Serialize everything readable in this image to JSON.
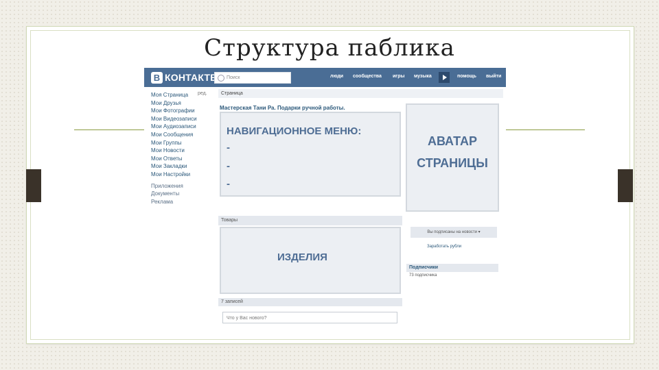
{
  "slide": {
    "title": "Структура паблика"
  },
  "vk": {
    "logo_mark": "В",
    "logo_text": "КОНТАКТЕ",
    "search_placeholder": "Поиск",
    "nav": [
      "люди",
      "сообщества",
      "игры",
      "музыка",
      "помощь",
      "выйти"
    ],
    "sidebar": {
      "edit_label": "ред.",
      "items": [
        "Моя Страница",
        "Мои Друзья",
        "Мои Фотографии",
        "Мои Видеозаписи",
        "Мои Аудиозаписи",
        "Мои Сообщения",
        "Мои Группы",
        "Мои Новости",
        "Мои Ответы",
        "Мои Закладки",
        "Мои Настройки"
      ],
      "extra": [
        "Приложения",
        "Документы",
        "Реклама"
      ]
    },
    "breadcrumb": "Страница",
    "page_title": "Мастерская Тани Ра. Подарки ручной работы.",
    "nav_menu_box": {
      "heading": "НАВИГАЦИОННОЕ МЕНЮ:",
      "lines": [
        "-",
        "-",
        "-"
      ]
    },
    "avatar_box": {
      "line1": "АВАТАР",
      "line2": "СТРАНИЦЫ"
    },
    "goods_header": "Товары",
    "goods_box": "ИЗДЕЛИЯ",
    "subscribe_button": "Вы подписаны на новости  ▾",
    "ruble_link": "Заработать рубли",
    "subscribers_header": "Подписчики",
    "subscribers_count": "73 подписчика",
    "posts_header": "7 записей",
    "post_placeholder": "Что у Вас нового?"
  },
  "colors": {
    "vk_blue": "#4a6d95",
    "deco_green": "#8a9a40",
    "deco_tab": "#3a3229",
    "box_text": "#4e6d94"
  }
}
